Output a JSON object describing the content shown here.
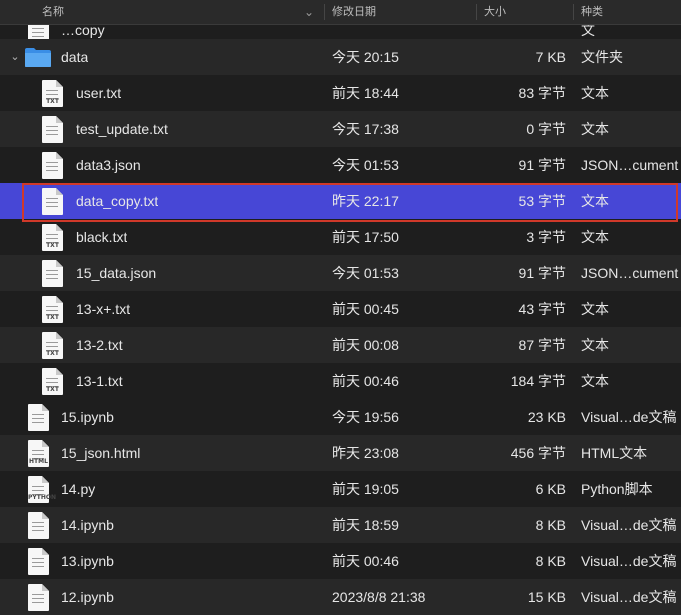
{
  "columns": {
    "name": "名称",
    "date": "修改日期",
    "size": "大小",
    "kind": "种类"
  },
  "colors": {
    "selection": "#4747d6",
    "highlight_border": "#d0392a"
  },
  "top_partial": {
    "name": "…copy",
    "kind": "文"
  },
  "folder": {
    "name": "data",
    "date": "今天 20:15",
    "size": "7 KB",
    "kind": "文件夹",
    "icon": "folder-icon",
    "expanded": true
  },
  "children": [
    {
      "name": "user.txt",
      "date": "前天 18:44",
      "size": "83 字节",
      "kind": "文本",
      "tag": "TXT",
      "icon": "txt-file-icon"
    },
    {
      "name": "test_update.txt",
      "date": "今天 17:38",
      "size": "0 字节",
      "kind": "文本",
      "tag": "",
      "icon": "txt-file-icon"
    },
    {
      "name": "data3.json",
      "date": "今天 01:53",
      "size": "91 字节",
      "kind": "JSON…cument",
      "tag": "",
      "icon": "json-file-icon"
    },
    {
      "name": "data_copy.txt",
      "date": "昨天 22:17",
      "size": "53 字节",
      "kind": "文本",
      "tag": "",
      "icon": "txt-file-icon",
      "selected": true
    },
    {
      "name": "black.txt",
      "date": "前天 17:50",
      "size": "3 字节",
      "kind": "文本",
      "tag": "TXT",
      "icon": "txt-file-icon"
    },
    {
      "name": "15_data.json",
      "date": "今天 01:53",
      "size": "91 字节",
      "kind": "JSON…cument",
      "tag": "",
      "icon": "json-file-icon"
    },
    {
      "name": "13-x+.txt",
      "date": "前天 00:45",
      "size": "43 字节",
      "kind": "文本",
      "tag": "TXT",
      "icon": "txt-file-icon"
    },
    {
      "name": "13-2.txt",
      "date": "前天 00:08",
      "size": "87 字节",
      "kind": "文本",
      "tag": "TXT",
      "icon": "txt-file-icon"
    },
    {
      "name": "13-1.txt",
      "date": "前天 00:46",
      "size": "184 字节",
      "kind": "文本",
      "tag": "TXT",
      "icon": "txt-file-icon"
    }
  ],
  "files": [
    {
      "name": "15.ipynb",
      "date": "今天 19:56",
      "size": "23 KB",
      "kind": "Visual…de文稿",
      "tag": "",
      "icon": "ipynb-file-icon"
    },
    {
      "name": "15_json.html",
      "date": "昨天 23:08",
      "size": "456 字节",
      "kind": "HTML文本",
      "tag": "HTML",
      "icon": "html-file-icon"
    },
    {
      "name": "14.py",
      "date": "前天 19:05",
      "size": "6 KB",
      "kind": "Python脚本",
      "tag": "PYTHON",
      "icon": "python-file-icon"
    },
    {
      "name": "14.ipynb",
      "date": "前天 18:59",
      "size": "8 KB",
      "kind": "Visual…de文稿",
      "tag": "",
      "icon": "ipynb-file-icon"
    },
    {
      "name": "13.ipynb",
      "date": "前天 00:46",
      "size": "8 KB",
      "kind": "Visual…de文稿",
      "tag": "",
      "icon": "ipynb-file-icon"
    },
    {
      "name": "12.ipynb",
      "date": "2023/8/8 21:38",
      "size": "15 KB",
      "kind": "Visual…de文稿",
      "tag": "",
      "icon": "ipynb-file-icon"
    }
  ]
}
